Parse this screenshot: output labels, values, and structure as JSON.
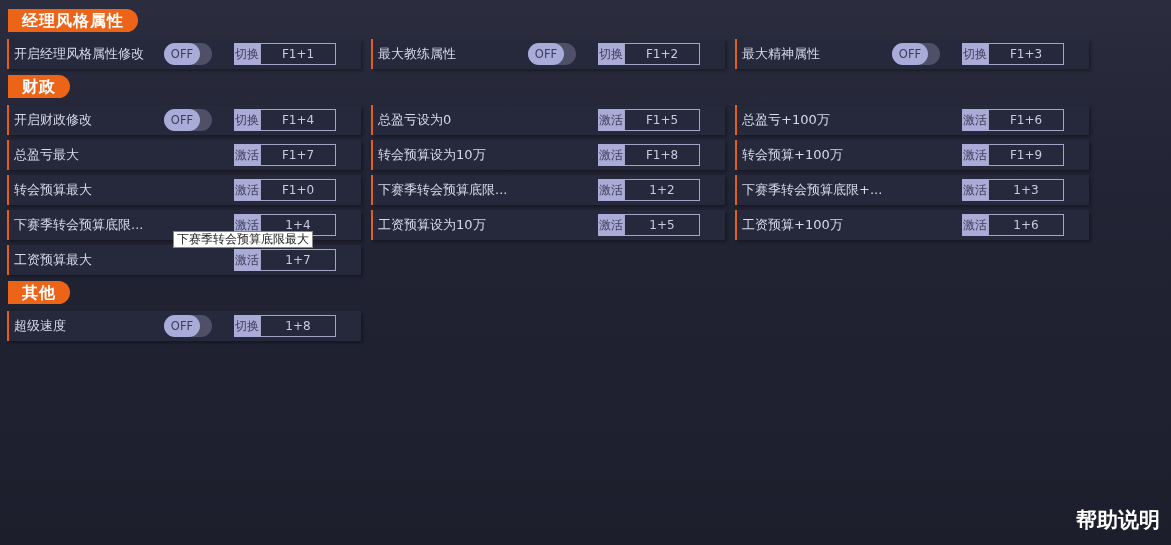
{
  "sections": [
    {
      "title": "经理风格属性",
      "items": [
        {
          "label": "开启经理风格属性修改",
          "kind": "toggle",
          "on": false,
          "toggle_text": "OFF",
          "action": "切换",
          "hotkey": "F1+1"
        },
        {
          "label": "最大教练属性",
          "kind": "toggle",
          "on": false,
          "toggle_text": "OFF",
          "action": "切换",
          "hotkey": "F1+2"
        },
        {
          "label": "最大精神属性",
          "kind": "toggle",
          "on": false,
          "toggle_text": "OFF",
          "action": "切换",
          "hotkey": "F1+3"
        }
      ]
    },
    {
      "title": "财政",
      "items": [
        {
          "label": "开启财政修改",
          "kind": "toggle",
          "on": false,
          "toggle_text": "OFF",
          "action": "切换",
          "hotkey": "F1+4"
        },
        {
          "label": "总盈亏设为0",
          "kind": "button",
          "action": "激活",
          "hotkey": "F1+5"
        },
        {
          "label": "总盈亏+100万",
          "kind": "button",
          "action": "激活",
          "hotkey": "F1+6"
        },
        {
          "label": "总盈亏最大",
          "kind": "button",
          "action": "激活",
          "hotkey": "F1+7"
        },
        {
          "label": "转会预算设为10万",
          "kind": "button",
          "action": "激活",
          "hotkey": "F1+8"
        },
        {
          "label": "转会预算+100万",
          "kind": "button",
          "action": "激活",
          "hotkey": "F1+9"
        },
        {
          "label": "转会预算最大",
          "kind": "button",
          "action": "激活",
          "hotkey": "F1+0"
        },
        {
          "label": "下赛季转会预算底限...",
          "kind": "button",
          "action": "激活",
          "hotkey": "1+2"
        },
        {
          "label": "下赛季转会预算底限+...",
          "kind": "button",
          "action": "激活",
          "hotkey": "1+3"
        },
        {
          "label": "下赛季转会预算底限...",
          "kind": "button",
          "action": "激活",
          "hotkey": "1+4",
          "tooltip": "下赛季转会预算底限最大"
        },
        {
          "label": "工资预算设为10万",
          "kind": "button",
          "action": "激活",
          "hotkey": "1+5"
        },
        {
          "label": "工资预算+100万",
          "kind": "button",
          "action": "激活",
          "hotkey": "1+6"
        },
        {
          "label": "工资预算最大",
          "kind": "button",
          "action": "激活",
          "hotkey": "1+7"
        }
      ]
    },
    {
      "title": "其他",
      "items": [
        {
          "label": "超级速度",
          "kind": "toggle",
          "on": false,
          "toggle_text": "OFF",
          "action": "切换",
          "hotkey": "1+8"
        }
      ]
    }
  ],
  "help_link": "帮助说明"
}
